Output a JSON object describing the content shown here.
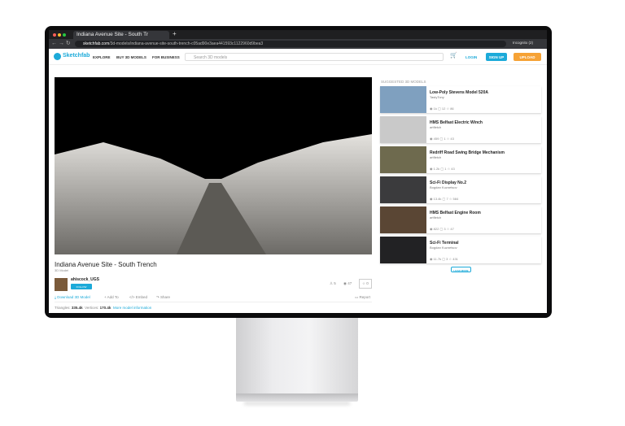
{
  "browser": {
    "tab_title": "Indiana Avenue Site - South Tr",
    "url_domain": "sketchfab.com",
    "url_path": "/3d-models/indiana-avenue-site-south-trench-c05ad90e3aea441593c1122960d9bea3",
    "profile": "Incognito (2)"
  },
  "header": {
    "logo": "Sketchfab",
    "nav": [
      "EXPLORE",
      "BUY 3D MODELS",
      "FOR BUSINESS"
    ],
    "search_placeholder": "Search 3D models",
    "login": "LOGIN",
    "signup": "SIGN UP",
    "upload": "UPLOAD",
    "accent": "#1caad9",
    "upload_color": "#f6a235"
  },
  "model": {
    "title": "Indiana Avenue Site - South Trench",
    "subtitle": "3D Model",
    "author": "ahiscock_UGS",
    "follow": "FOLLOW",
    "likes": "5",
    "views": "47",
    "stars": "0",
    "actions": {
      "download": "Download 3D Model",
      "add_to": "Add To",
      "embed": "Embed",
      "share": "Share",
      "report": "Report"
    },
    "triangles_label": "Triangles:",
    "triangles": "335.4k",
    "vertices_label": "Vertices:",
    "vertices": "170.4k",
    "more_info": "More model information"
  },
  "sidebar": {
    "title": "SUGGESTED 3D MODELS",
    "load_more": "LOAD MORE",
    "items": [
      {
        "title": "Low-Poly Stevens Model 520A",
        "author": "TastyTony",
        "views": "1k",
        "comments": "12",
        "likes": "86",
        "thumb": "#7fa0bf"
      },
      {
        "title": "HMS Belfast Electric Winch",
        "author": "artfletch",
        "views": "459",
        "comments": "1",
        "likes": "43",
        "thumb": "#c9c9c9"
      },
      {
        "title": "Redriff Road Swing Bridge Mechanism",
        "author": "artfletch",
        "views": "1.2k",
        "comments": "1",
        "likes": "43",
        "thumb": "#6e6a4e"
      },
      {
        "title": "Sci-Fi Display No.2",
        "author": "Bogdan Kuznetsov",
        "views": "13.4k",
        "comments": "7",
        "likes": "584",
        "thumb": "#3b3b3d"
      },
      {
        "title": "HMS Belfast Engine Room",
        "author": "artfletch",
        "views": "822",
        "comments": "3",
        "likes": "47",
        "thumb": "#5a4634"
      },
      {
        "title": "Sci-Fi Terminal",
        "author": "Bogdan Kuznetsov",
        "views": "11.7k",
        "comments": "3",
        "likes": "431",
        "thumb": "#222224"
      }
    ]
  }
}
